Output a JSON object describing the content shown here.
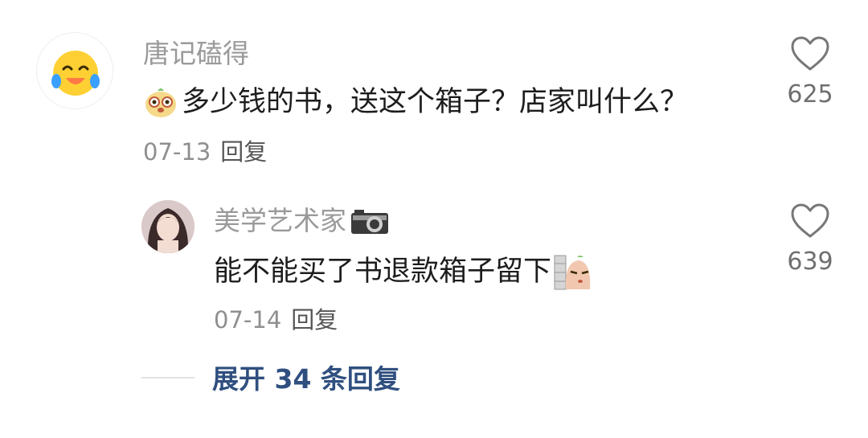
{
  "comment": {
    "username": "唐记磕得",
    "text": "多少钱的书，送这个箱子？店家叫什么？",
    "date": "07-13",
    "reply_label": "回复",
    "likes": "625",
    "avatar_icon": "laughing-crying-face-icon",
    "emoji_icon": "cute-cat-face-icon"
  },
  "reply": {
    "username": "美学艺术家",
    "username_badge_icon": "camera-icon",
    "text": "能不能买了书退款箱子留下",
    "emoji_icon": "peeking-behind-wall-icon",
    "date": "07-14",
    "reply_label": "回复",
    "likes": "639"
  },
  "expand": {
    "label": "展开 34 条回复"
  },
  "colors": {
    "username": "#9a9a9a",
    "body_text": "#1d1d1d",
    "meta": "#8f8f8f",
    "link": "#2f4f7f",
    "likes": "#6f6f6f"
  }
}
